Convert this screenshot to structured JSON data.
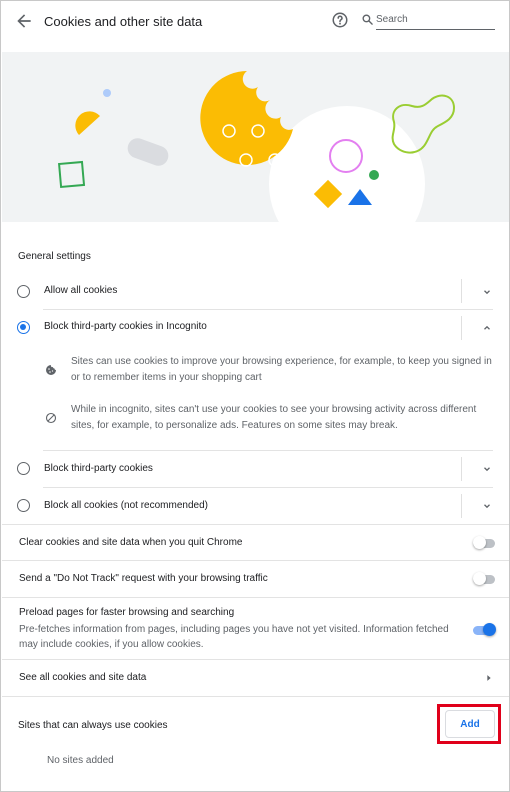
{
  "header": {
    "title": "Cookies and other site data",
    "search_placeholder": "Search",
    "icons": {
      "back": "back-arrow-icon",
      "help": "help-icon",
      "search": "search-icon"
    }
  },
  "general_settings": {
    "label": "General settings",
    "options": [
      {
        "label": "Allow all cookies",
        "selected": false,
        "expanded": false
      },
      {
        "label": "Block third-party cookies in Incognito",
        "selected": true,
        "expanded": true
      },
      {
        "label": "Block third-party cookies",
        "selected": false,
        "expanded": false
      },
      {
        "label": "Block all cookies (not recommended)",
        "selected": false,
        "expanded": false
      }
    ],
    "incognito_details": [
      {
        "icon": "cookie-icon",
        "text": "Sites can use cookies to improve your browsing experience, for example, to keep you signed in or to remember items in your shopping cart"
      },
      {
        "icon": "block-icon",
        "text": "While in incognito, sites can't use your cookies to see your browsing activity across different sites, for example, to personalize ads. Features on some sites may break."
      }
    ]
  },
  "toggles": [
    {
      "label": "Clear cookies and site data when you quit Chrome",
      "on": false
    },
    {
      "label": "Send a \"Do Not Track\" request with your browsing traffic",
      "on": false
    },
    {
      "label": "Preload pages for faster browsing and searching",
      "sublabel": "Pre-fetches information from pages, including pages you have not yet visited. Information fetched may include cookies, if you allow cookies.",
      "on": true
    }
  ],
  "see_all": {
    "label": "See all cookies and site data"
  },
  "always_allow": {
    "label": "Sites that can always use cookies",
    "add_label": "Add",
    "empty_text": "No sites added"
  },
  "colors": {
    "accent": "#1a73e8",
    "banner_bg": "#f1f3f4",
    "cookie_yellow": "#fbbc04",
    "highlight": "#e0001a"
  }
}
